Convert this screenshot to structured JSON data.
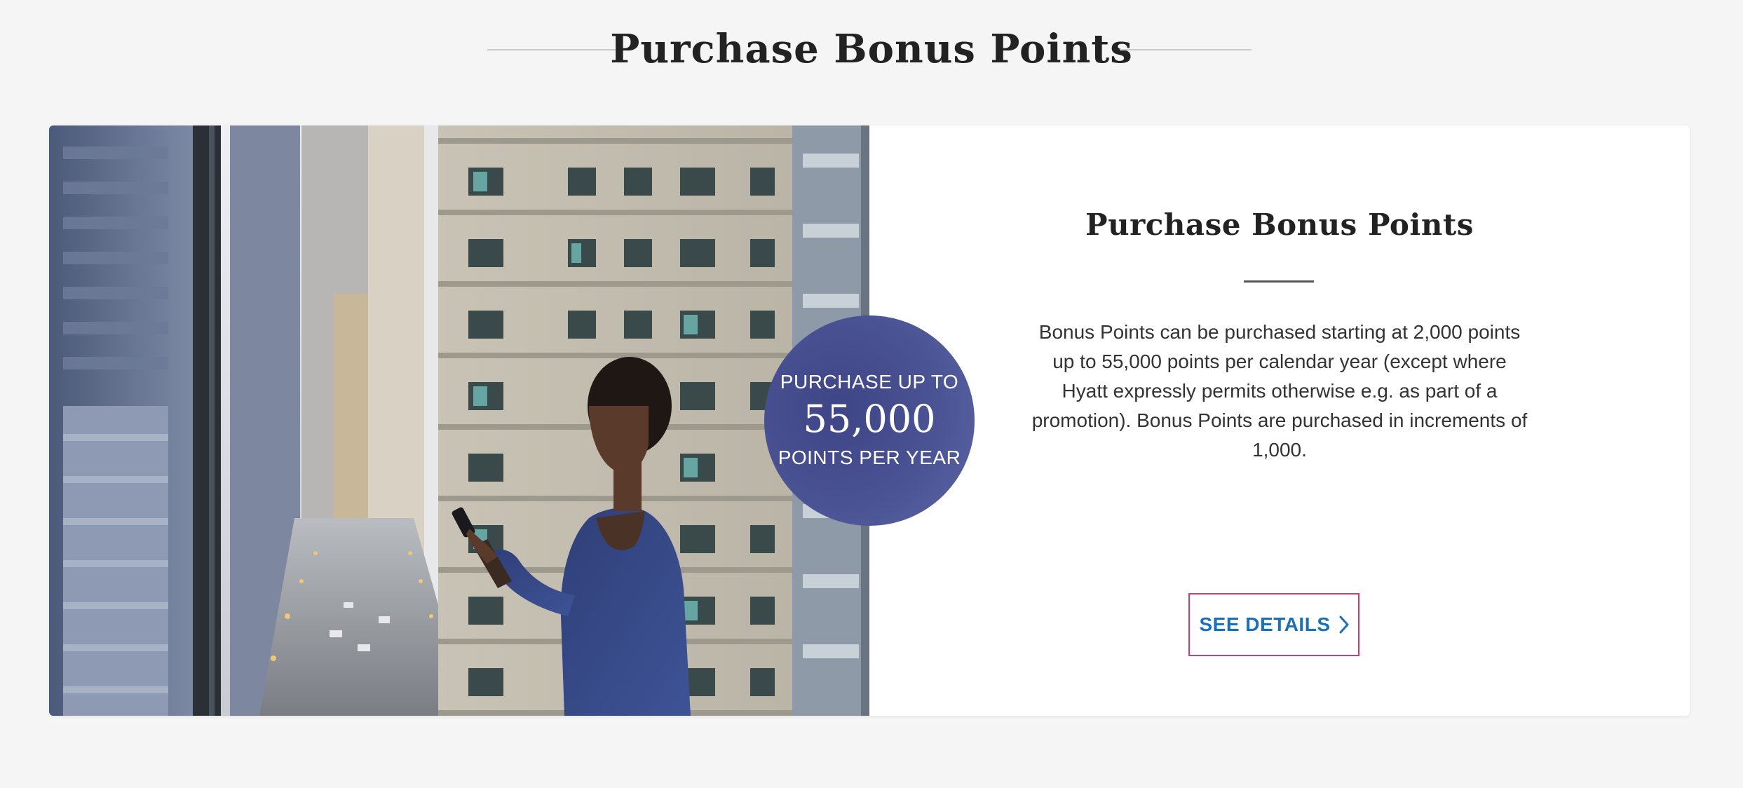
{
  "section": {
    "title": "Purchase Bonus Points"
  },
  "card": {
    "image_alt": "Woman looking at phone by window overlooking city street",
    "badge": {
      "top_text": "PURCHASE UP TO",
      "number": "55,000",
      "bottom_text": "POINTS PER YEAR",
      "color": "#4a5394"
    },
    "title": "Purchase Bonus Points",
    "description": "Bonus Points can be purchased starting at 2,000 points up to 55,000 points per calendar year (except where Hyatt expressly permits otherwise e.g. as part of a promotion). Bonus Points are purchased in increments of 1,000.",
    "cta": {
      "label": "SEE DETAILS",
      "icon": "chevron-right-icon",
      "border_color": "#d7386d",
      "text_color": "#1d6fb8"
    }
  }
}
